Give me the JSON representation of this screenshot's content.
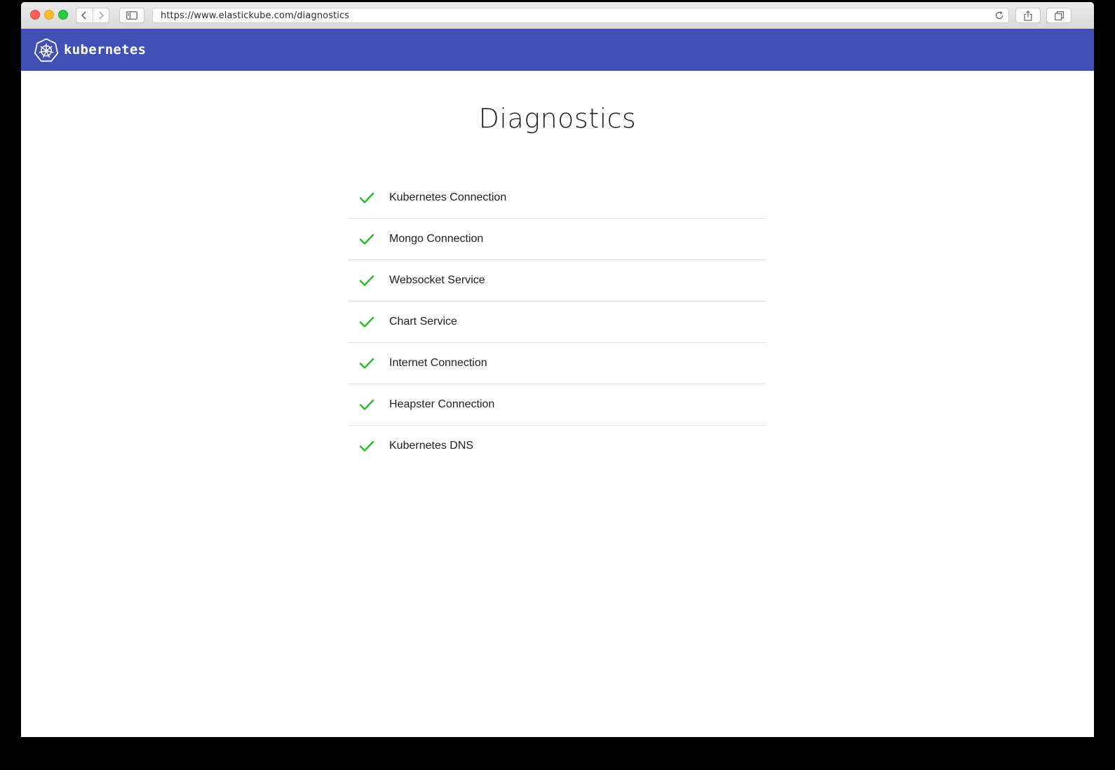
{
  "browser": {
    "url": "https://www.elastickube.com/diagnostics",
    "icons": {
      "back": "chevron-left-icon",
      "forward": "chevron-right-icon",
      "sidebar": "sidebar-icon",
      "reload": "reload-icon",
      "share": "share-icon",
      "tabs": "tabs-icon"
    }
  },
  "appbar": {
    "brand": "kubernetes",
    "logo_icon": "kubernetes-wheel-icon",
    "color": "#3f51b5"
  },
  "main": {
    "title": "Diagnostics",
    "check_color": "#2ebd2e",
    "items": [
      {
        "label": "Kubernetes Connection",
        "status": "ok"
      },
      {
        "label": "Mongo Connection",
        "status": "ok"
      },
      {
        "label": "Websocket Service",
        "status": "ok"
      },
      {
        "label": "Chart Service",
        "status": "ok"
      },
      {
        "label": "Internet Connection",
        "status": "ok"
      },
      {
        "label": "Heapster Connection",
        "status": "ok"
      },
      {
        "label": "Kubernetes DNS",
        "status": "ok"
      }
    ]
  }
}
